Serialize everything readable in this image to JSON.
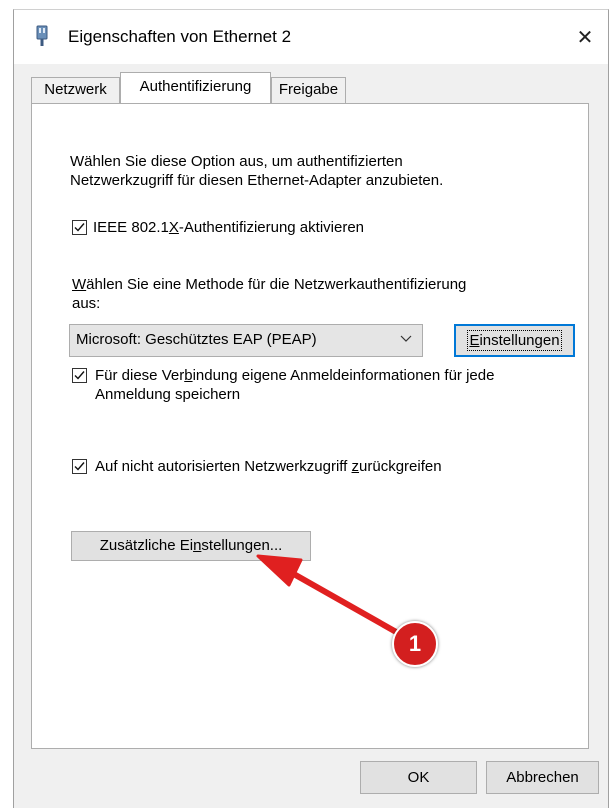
{
  "window": {
    "title": "Eigenschaften von Ethernet 2",
    "close_glyph": "✕",
    "icon": "network-adapter-icon"
  },
  "tabs": [
    {
      "label": "Netzwerk",
      "active": false
    },
    {
      "label": "Authentifizierung",
      "active": true
    },
    {
      "label": "Freigabe",
      "active": false
    }
  ],
  "auth": {
    "intro_line1": "Wählen Sie diese Option aus, um authentifizierten",
    "intro_line2": "Netzwerkzugriff für diesen Ethernet-Adapter anzubieten.",
    "enable_8021x": {
      "label_pre": "IEEE 802.1",
      "label_u": "X",
      "label_post": "-Authentifizierung aktivieren",
      "checked": true
    },
    "method_label_u": "W",
    "method_label_rest": "ählen Sie eine Methode für die Netzwerkauthentifizierung",
    "method_label_line2": "aus:",
    "method_value": "Microsoft: Geschütztes EAP (PEAP)",
    "settings_button": {
      "u": "E",
      "rest": "instellungen"
    },
    "remember_creds": {
      "line1_pre": "Für diese Ver",
      "line1_u": "b",
      "line1_post": "indung eigene Anmeldeinformationen für jede",
      "line2": "Anmeldung speichern",
      "checked": true
    },
    "fallback": {
      "pre": "Auf nicht autorisierten Netzwerkzugriff ",
      "u": "z",
      "post": "urückgreifen",
      "checked": true
    },
    "additional_button": {
      "pre": "Zusätzliche Ei",
      "u": "n",
      "post": "stellungen..."
    }
  },
  "footer": {
    "ok_label": "OK",
    "cancel_label": "Abbrechen"
  },
  "annotation": {
    "badge_number": "1",
    "arrow_color": "#e02020",
    "badge_color": "#d31f1f"
  }
}
